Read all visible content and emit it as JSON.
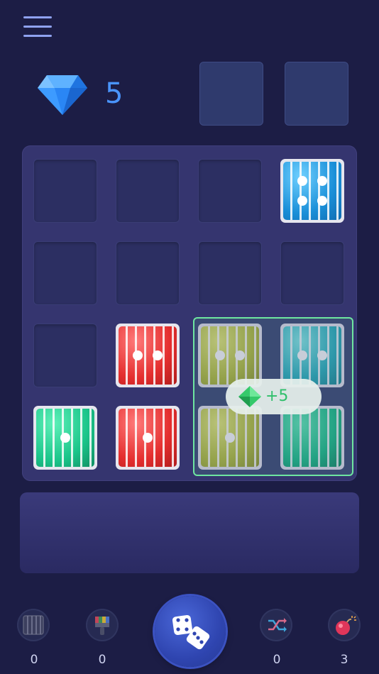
{
  "gems": {
    "count": "5"
  },
  "reward": {
    "text": "+5"
  },
  "tools": {
    "cage": {
      "count": "0"
    },
    "paint": {
      "count": "0"
    },
    "shuffle": {
      "count": "0"
    },
    "bomb": {
      "count": "3"
    }
  },
  "board": {
    "rows": 4,
    "cols": 4,
    "dice": [
      {
        "row": 0,
        "col": 3,
        "color": "blue",
        "value": 4
      },
      {
        "row": 2,
        "col": 1,
        "color": "red",
        "value": 2
      },
      {
        "row": 3,
        "col": 0,
        "color": "green",
        "value": 1
      },
      {
        "row": 3,
        "col": 1,
        "color": "red",
        "value": 1
      },
      {
        "row": 2,
        "col": 2,
        "color": "yellow",
        "value": 2,
        "ghost": true
      },
      {
        "row": 2,
        "col": 3,
        "color": "teal",
        "value": 2,
        "ghost": true
      },
      {
        "row": 3,
        "col": 2,
        "color": "yellow",
        "value": 1,
        "ghost": true
      },
      {
        "row": 3,
        "col": 3,
        "color": "green",
        "value": 0,
        "ghost": true
      }
    ]
  },
  "colors": {
    "background": "#1c1d45",
    "board": "#35356f",
    "gem_text": "#4a95ff",
    "reward_text": "#2fbf6b",
    "merge_border": "#6ee6a0"
  }
}
